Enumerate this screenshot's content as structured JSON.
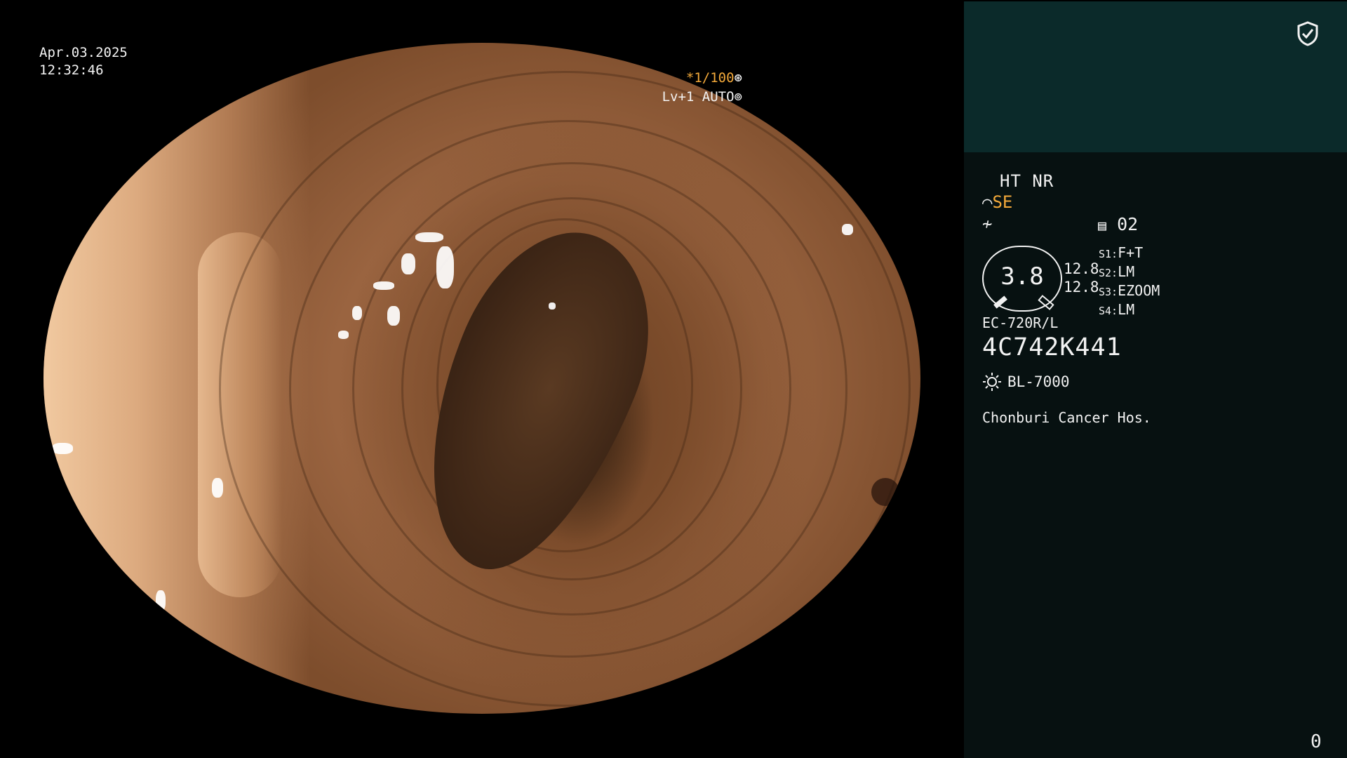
{
  "overlay": {
    "date": "Apr.03.2025",
    "time": "12:32:46",
    "shutter": "*1/100",
    "shutter_icon": "aperture-icon",
    "iris": "Lv+1 AUTO",
    "iris_icon": "iris-icon"
  },
  "panel": {
    "shield_icon": "shield-check-icon",
    "ht_nr": "HT NR",
    "se_label": "SE",
    "se_icon": "structure-enhance-icon",
    "f_icon": "freeze-icon",
    "storage_icon": "memory-card-icon",
    "storage_count": "02",
    "gauge_value": "3.8",
    "gauge_side_1": "12.8",
    "gauge_side_2": "12.8",
    "switches": [
      {
        "key": "S1:",
        "value": "F+T"
      },
      {
        "key": "S2:",
        "value": "LM"
      },
      {
        "key": "S3:",
        "value": "EZOOM"
      },
      {
        "key": "S4:",
        "value": "LM"
      }
    ],
    "scope_model": "EC-720R/L",
    "serial": "4C742K441",
    "light_icon": "light-source-icon",
    "light_source": "BL-7000",
    "hospital": "Chonburi Cancer Hos.",
    "counter": "0"
  },
  "colors": {
    "accent_orange": "#f3a93a",
    "panel_top": "#0b2a2a",
    "panel_main": "#071111"
  }
}
